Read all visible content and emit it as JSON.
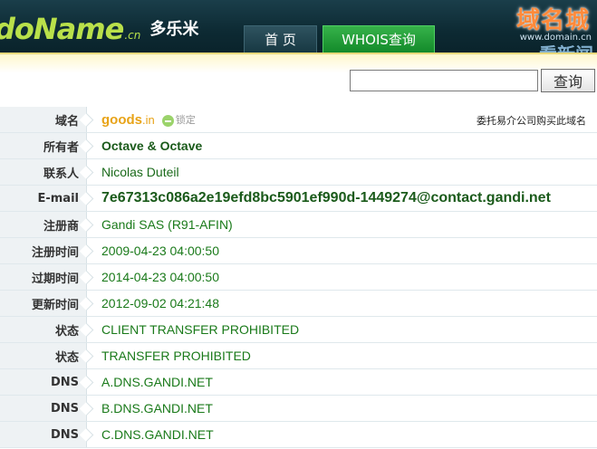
{
  "header": {
    "logo_main": "doName",
    "logo_suffix": ".cn",
    "logo_cn": "多乐米",
    "tabs": [
      {
        "label": "首 页"
      },
      {
        "label": "WHOIS查询"
      }
    ]
  },
  "watermark": {
    "title": "域名城",
    "url": "www.domain.cn",
    "sub": "看新闻"
  },
  "search": {
    "value": "",
    "placeholder": "",
    "button_label": "查询"
  },
  "whois": {
    "domain_name": "goods",
    "domain_tld": ".in",
    "lock_label": "锁定",
    "broker_link": "委托易介公司购买此域名",
    "rows": [
      {
        "label": "域名"
      },
      {
        "label": "所有者",
        "value": "Octave & Octave"
      },
      {
        "label": "联系人",
        "value": "Nicolas Duteil"
      },
      {
        "label": "E-mail",
        "value": "7e67313c086a2e19efd8bc5901ef990d-1449274@contact.gandi.net"
      },
      {
        "label": "注册商",
        "value": "Gandi SAS (R91-AFIN)"
      },
      {
        "label": "注册时间",
        "value": "2009-04-23 04:00:50"
      },
      {
        "label": "过期时间",
        "value": "2014-04-23 04:00:50"
      },
      {
        "label": "更新时间",
        "value": "2012-09-02 04:21:48"
      },
      {
        "label": "状态",
        "value": "CLIENT TRANSFER PROHIBITED"
      },
      {
        "label": "状态",
        "value": "TRANSFER PROHIBITED"
      },
      {
        "label": "DNS",
        "value": "A.DNS.GANDI.NET"
      },
      {
        "label": "DNS",
        "value": "B.DNS.GANDI.NET"
      },
      {
        "label": "DNS",
        "value": "C.DNS.GANDI.NET"
      }
    ]
  },
  "colors": {
    "header_bg": "#0d2a33",
    "logo_green": "#b9e04a",
    "tab_active": "#138a2a",
    "value_green": "#1a7a1a",
    "domain_orange": "#e8a317"
  }
}
